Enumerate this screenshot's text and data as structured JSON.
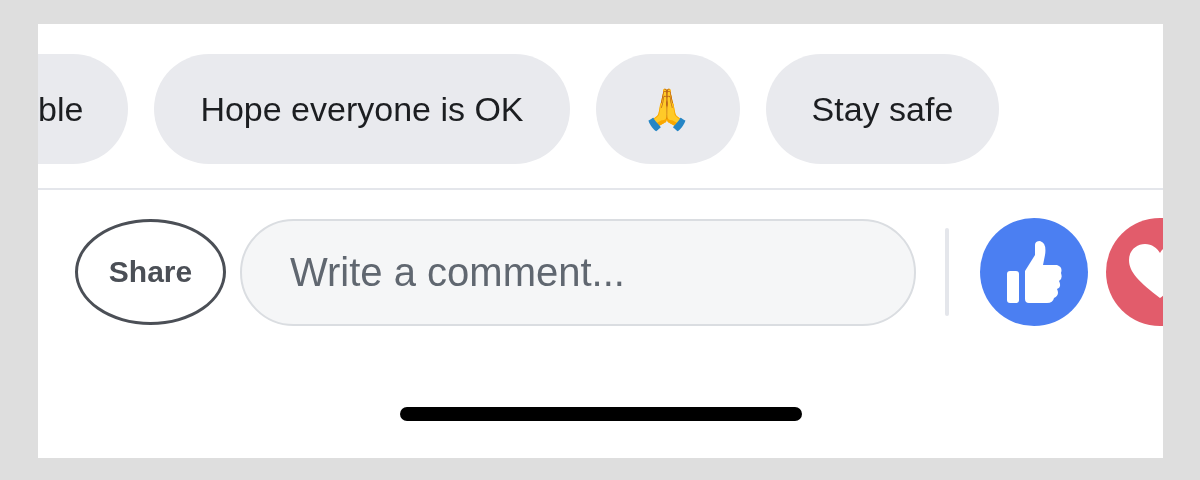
{
  "quick_replies": [
    {
      "kind": "text",
      "label": "ble"
    },
    {
      "kind": "text",
      "label": "Hope everyone is OK"
    },
    {
      "kind": "emoji",
      "emoji": "🙏"
    },
    {
      "kind": "text",
      "label": "Stay safe"
    }
  ],
  "share_button": {
    "label": "Share"
  },
  "comment_field": {
    "placeholder": "Write a comment..."
  },
  "reactions": [
    {
      "kind": "like",
      "color": "#4b7ff2"
    },
    {
      "kind": "love",
      "color": "#e25c6b"
    }
  ]
}
